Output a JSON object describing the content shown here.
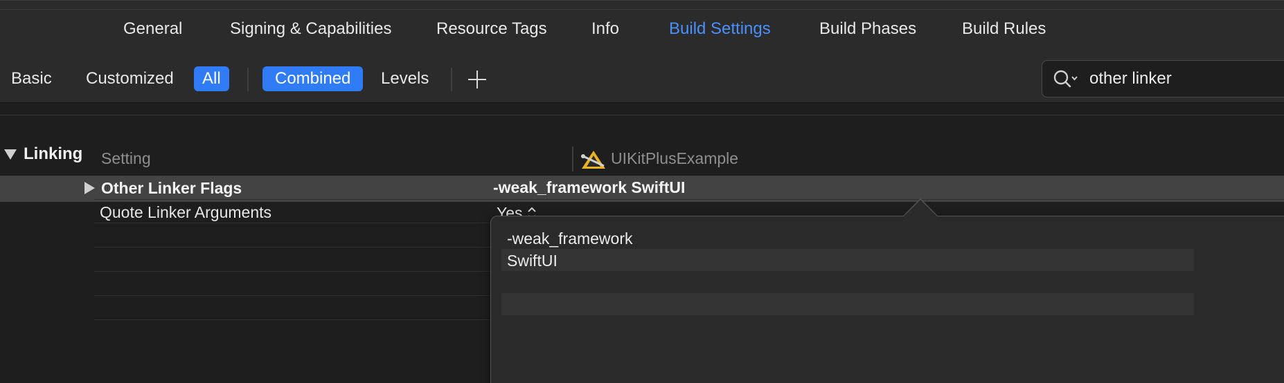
{
  "tabs": [
    {
      "label": "General"
    },
    {
      "label": "Signing & Capabilities"
    },
    {
      "label": "Resource Tags"
    },
    {
      "label": "Info"
    },
    {
      "label": "Build Settings",
      "active": true
    },
    {
      "label": "Build Phases"
    },
    {
      "label": "Build Rules"
    }
  ],
  "filters": {
    "basic": "Basic",
    "customized": "Customized",
    "all": "All",
    "combined": "Combined",
    "levels": "Levels"
  },
  "search": {
    "value": "other linker"
  },
  "section": {
    "title": "Linking"
  },
  "columns": {
    "setting": "Setting",
    "target": "UIKitPlusExample"
  },
  "rows": [
    {
      "name": "Other Linker Flags",
      "value": "-weak_framework SwiftUI",
      "selected": true
    },
    {
      "name": "Quote Linker Arguments",
      "value": "Yes"
    }
  ],
  "popover": {
    "items": [
      "-weak_framework",
      "SwiftUI"
    ]
  },
  "colors": {
    "accent": "#2f7cf6",
    "active_tab": "#4a90ff",
    "background": "#1e1e1e",
    "toolbar": "#2b2b2b",
    "selected_row": "#434343"
  },
  "icons": {
    "search": "magnifier-dropdown-icon",
    "add": "plus-icon",
    "target": "xcode-app-icon",
    "stepper": "up-down-stepper-icon"
  }
}
